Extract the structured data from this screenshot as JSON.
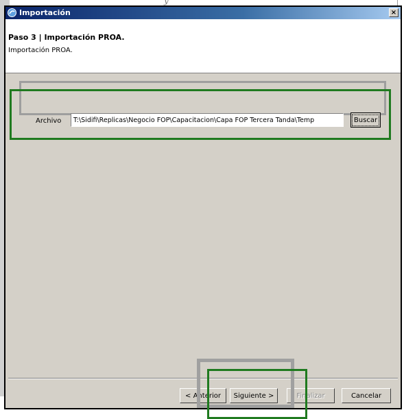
{
  "window": {
    "title": "Importación",
    "close_label": "×"
  },
  "header": {
    "step_title": "Paso 3 | Importación PROA.",
    "subtitle": "Importación PROA."
  },
  "file_section": {
    "label": "Archivo",
    "path_value": "T:\\Sidifi\\Replicas\\Negocio FOP\\Capacitacion\\Capa FOP Tercera Tanda\\Temp",
    "browse_label": "Buscar"
  },
  "footer": {
    "back_label": "< Anterior",
    "next_label": "Siguiente >",
    "finish_label": "Finalizar",
    "cancel_label": "Cancelar"
  },
  "colors": {
    "highlight_green": "#1f7a1f",
    "highlight_gray": "#a0a0a0",
    "titlebar": "#0a246a"
  },
  "icons": {
    "window_icon": "wizard-icon"
  }
}
